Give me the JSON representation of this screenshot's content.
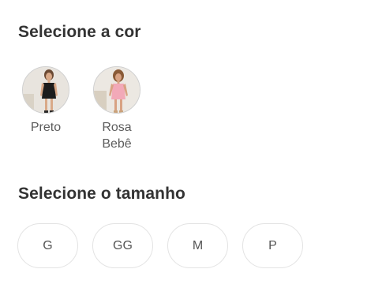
{
  "color_section": {
    "title": "Selecione a cor",
    "options": [
      {
        "label": "Preto",
        "icon": "model-black-dress-thumbnail",
        "dress_color": "#1c1c1c"
      },
      {
        "label": "Rosa Bebê",
        "icon": "model-pink-dress-thumbnail",
        "dress_color": "#f2a9b8"
      }
    ]
  },
  "size_section": {
    "title": "Selecione o tamanho",
    "options": [
      "G",
      "GG",
      "M",
      "P"
    ]
  },
  "colors": {
    "title_text": "#333333",
    "label_text": "#5c5c5c",
    "button_border": "#e3e3e3"
  }
}
